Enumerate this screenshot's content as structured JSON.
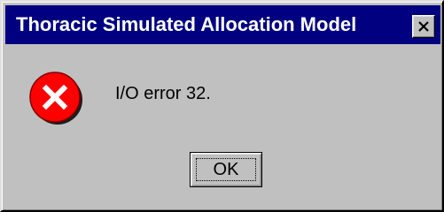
{
  "window": {
    "title": "Thoracic Simulated Allocation Model",
    "title_bar_color": "#000080",
    "close_icon": "close-x-icon"
  },
  "dialog": {
    "icon": "error-icon",
    "icon_color": "#ff0000",
    "message": "I/O error 32.",
    "ok_label": "OK"
  }
}
